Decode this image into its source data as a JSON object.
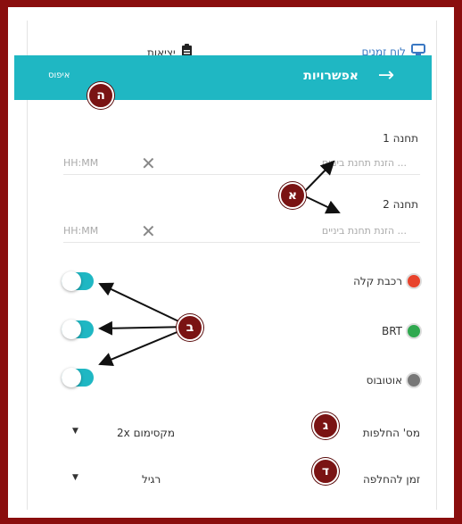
{
  "topbar": {
    "timetable_label": "לוח זמנים",
    "exit_label": "יציאות"
  },
  "options_bar": {
    "title": "אפשרויות",
    "reset_label": "איפוס"
  },
  "stops": [
    {
      "label": "תחנה 1",
      "placeholder": "... הזנת תחנת ביניים",
      "time_placeholder": "HH:MM"
    },
    {
      "label": "תחנה 2",
      "placeholder": "... הזנת תחנת ביניים",
      "time_placeholder": "HH:MM"
    }
  ],
  "modes": [
    {
      "label": "רכבת קלה",
      "color": "#e8432c",
      "enabled": true
    },
    {
      "label": "BRT",
      "color": "#2fa84f",
      "enabled": true
    },
    {
      "label": "אוטובוס",
      "color": "#777777",
      "enabled": true
    }
  ],
  "settings": {
    "transfers_label": "מס' החלפות",
    "transfers_value": "מקסימום 2x",
    "transfer_time_label": "זמן להחלפה",
    "transfer_time_value": "רגיל"
  },
  "annotations": {
    "a": "א",
    "b": "ב",
    "c": "ג",
    "d": "ד",
    "e": "ה"
  },
  "colors": {
    "frame": "#8a0e0e",
    "accent": "#1fb7c3",
    "badge": "#7a1313"
  }
}
